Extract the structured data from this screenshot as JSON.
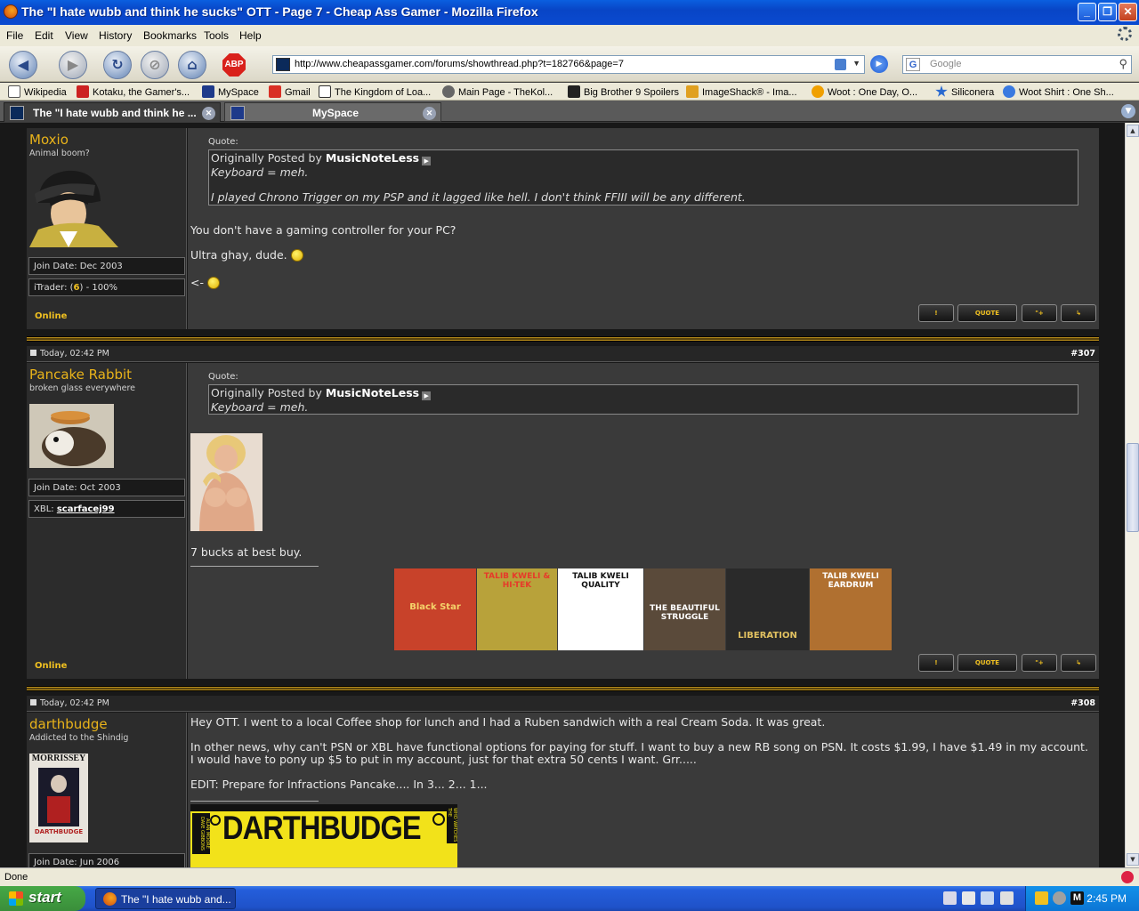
{
  "window": {
    "title": "The \"I hate wubb and think he sucks\" OTT - Page 7 - Cheap Ass Gamer - Mozilla Firefox"
  },
  "menu": [
    "File",
    "Edit",
    "View",
    "History",
    "Bookmarks",
    "Tools",
    "Help"
  ],
  "nav": {
    "url": "http://www.cheapassgamer.com/forums/showthread.php?t=182766&page=7",
    "search_placeholder": "Google",
    "abp": "ABP"
  },
  "bookmarks": [
    {
      "label": "Wikipedia",
      "icon": "wikipedia-icon",
      "color": "#ffffff"
    },
    {
      "label": "Kotaku, the Gamer's...",
      "icon": "kotaku-icon",
      "color": "#cc2222"
    },
    {
      "label": "MySpace",
      "icon": "myspace-icon",
      "color": "#1e3a8a"
    },
    {
      "label": "Gmail",
      "icon": "gmail-icon",
      "color": "#d93025"
    },
    {
      "label": "The Kingdom of Loa...",
      "icon": "kingdom-icon",
      "color": "#333333"
    },
    {
      "label": "Main Page - TheKol...",
      "icon": "kol-icon",
      "color": "#666666"
    },
    {
      "label": "Big Brother 9 Spoilers",
      "icon": "bb-icon",
      "color": "#222222"
    },
    {
      "label": "ImageShack® - Ima...",
      "icon": "imageshack-icon",
      "color": "#e0a020"
    },
    {
      "label": "Woot : One Day, O...",
      "icon": "woot-icon",
      "color": "#f0a000"
    },
    {
      "label": "Siliconera",
      "icon": "star-icon",
      "color": "#2a6ad0"
    },
    {
      "label": "Woot Shirt : One Sh...",
      "icon": "info-icon",
      "color": "#3a7ae0"
    }
  ],
  "tabs": [
    {
      "label": "The \"I hate wubb and think he ..."
    },
    {
      "label": "MySpace"
    }
  ],
  "posts": [
    {
      "user": "Moxio",
      "user_title": "Animal boom?",
      "join": "Join Date: Dec 2003",
      "extra_prefix": "iTrader: (",
      "extra_link": "6",
      "extra_suffix": ") - 100%",
      "status": "Online",
      "quote_label": "Quote:",
      "quote_prefix": "Originally Posted by",
      "quote_author": "MusicNoteLess",
      "quote_lines": [
        "Keyboard = meh.",
        "",
        "I played Chrono Trigger on my PSP and it lagged like hell. I don't think FFIII will be any different."
      ],
      "body": [
        "You don't have a gaming controller for your PC?",
        "Ultra ghay, dude.",
        "<-"
      ]
    },
    {
      "date": "Today, 02:42 PM",
      "num": "#307",
      "user": "Pancake Rabbit",
      "user_title": "broken glass everywhere",
      "join": "Join Date: Oct 2003",
      "extra_prefix": "XBL: ",
      "extra_link": "scarfacej99",
      "status": "Online",
      "quote_label": "Quote:",
      "quote_prefix": "Originally Posted by",
      "quote_author": "MusicNoteLess",
      "quote_lines": [
        "Keyboard = meh."
      ],
      "body": [
        "7 bucks at best buy."
      ],
      "albums": [
        {
          "label": "Black Star",
          "bg": "#c8422a",
          "fg": "#f5d36a"
        },
        {
          "label": "TALIB KWELI & HI-TEK",
          "bg": "#b8a23a",
          "fg": "#e63a2a"
        },
        {
          "label": "TALIB KWELI QUALITY",
          "bg": "#ffffff",
          "fg": "#111111"
        },
        {
          "label": "THE BEAUTIFUL STRUGGLE",
          "bg": "#5a4a3a",
          "fg": "#ffffff"
        },
        {
          "label": "LIBERATION",
          "bg": "#2a2a2a",
          "fg": "#e0c060"
        },
        {
          "label": "TALIB KWELI EARDRUM",
          "bg": "#b07030",
          "fg": "#ffffff"
        }
      ]
    },
    {
      "date": "Today, 02:42 PM",
      "num": "#308",
      "user": "darthbudge",
      "user_title": "Addicted to the Shindig",
      "join": "Join Date: Jun 2006",
      "avatar_top": "MORRISSEY",
      "avatar_bottom": "DARTHBUDGE",
      "body": [
        "Hey OTT. I went to a local Coffee shop for lunch and I had a Ruben sandwich with a real Cream Soda. It was great.",
        "In other news, why can't PSN or XBL have functional options for paying for stuff. I want to buy a new RB song on PSN. It costs $1.99, I have $1.49 in my account.",
        "I would have to pony up $5 to put in my account, just for that extra 50 cents I want. Grr.....",
        "EDIT: Prepare for Infractions Pancake.... In 3... 2... 1..."
      ],
      "banner": "DARTHBUDGE",
      "banner_side_1": "ALAN MOORE DAVE GIBBONS",
      "banner_side_2": "WHO WATCHES THE"
    }
  ],
  "post_buttons": {
    "report": "!",
    "quote": "QUOTE",
    "multiquote": "\"+",
    "reply": "↳"
  },
  "status": {
    "text": "Done"
  },
  "taskbar": {
    "start": "start",
    "item": "The \"I hate wubb and...",
    "clock": "2:45 PM"
  }
}
